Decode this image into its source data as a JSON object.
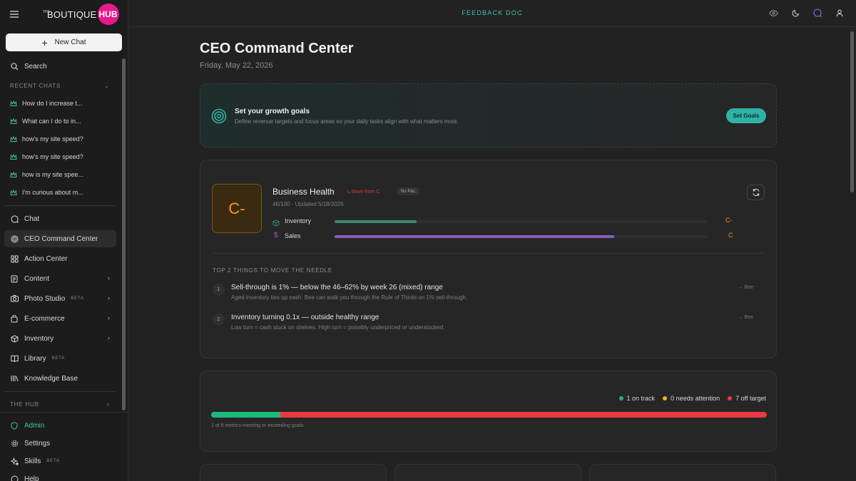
{
  "brand": {
    "the": "THE",
    "word": "BOUTIQUE",
    "hub": "HUB",
    "hub_color": "#e6198a"
  },
  "sidebar": {
    "new_chat": "New Chat",
    "search": "Search",
    "recent_title": "RECENT CHATS",
    "recent": [
      "How do I increase t...",
      "What can I do to in...",
      "how's my site speed?",
      "how's my site speed?",
      "how is my site spee...",
      "I'm curious about m..."
    ],
    "nav": [
      {
        "label": "Chat",
        "icon": "chat-bubble-icon"
      },
      {
        "label": "CEO Command Center",
        "icon": "target-icon",
        "active": true
      },
      {
        "label": "Action Center",
        "icon": "grid-icon"
      },
      {
        "label": "Content",
        "icon": "document-icon"
      },
      {
        "label": "Photo Studio",
        "icon": "camera-icon",
        "beta": "BETA"
      },
      {
        "label": "E-commerce",
        "icon": "shopping-bag-icon"
      },
      {
        "label": "Inventory",
        "icon": "box-icon"
      },
      {
        "label": "Library",
        "icon": "book-icon",
        "beta": "BETA"
      },
      {
        "label": "Knowledge Base",
        "icon": "books-icon"
      }
    ],
    "hub_title": "THE HUB",
    "bottom": [
      {
        "label": "Admin",
        "icon": "shield-icon"
      },
      {
        "label": "Settings",
        "icon": "gear-icon"
      },
      {
        "label": "Skills",
        "icon": "sparkle-icon",
        "beta": "BETA"
      },
      {
        "label": "Help",
        "icon": "help-icon"
      }
    ]
  },
  "topbar": {
    "title": "FEEDBACK DOC"
  },
  "main": {
    "title": "CEO Command Center",
    "date": "Friday, May 22, 2026",
    "goals": {
      "title": "Set your growth goals",
      "subtitle": "Define revenue targets and focus areas so your daily tasks align with what matters most.",
      "button": "Set Goals"
    },
    "health": {
      "grade": "C-",
      "title": "Business Health",
      "trend": "↘ down from C",
      "badge": "No P&L",
      "meta": "46/100 · Updated 5/18/2026",
      "metrics": [
        {
          "label": "Inventory",
          "grade": "C-",
          "fill": 0.22,
          "color": "#3a8a6c"
        },
        {
          "label": "Sales",
          "grade": "C",
          "fill": 0.75,
          "color": "#8a5cc0"
        }
      ],
      "needle_title": "TOP 2 THINGS TO MOVE THE NEEDLE",
      "needle": [
        {
          "num": "1",
          "title": "Sell-through is 1% — below the 46–62% by week 26 (mixed) range",
          "sub": "Aged inventory ties up cash. Bee can walk you through the Rule of Thirds on 1% sell-through.",
          "see": "→ Bee"
        },
        {
          "num": "2",
          "title": "Inventory turning 0.1x — outside healthy range",
          "sub": "Low turn = cash stuck on shelves. High turn = possibly underpriced or understocked.",
          "see": "→ Bee"
        }
      ]
    },
    "status": {
      "on_track": "1 on track",
      "attention": "0 needs attention",
      "off_target": "7 off target",
      "on_track_fraction": 0.125,
      "note": "1 of 8 metrics meeting or exceeding goals",
      "colors": {
        "on_track": "#1fb87b",
        "attention": "#e8b41d",
        "off_target": "#ea3a3f"
      }
    }
  }
}
